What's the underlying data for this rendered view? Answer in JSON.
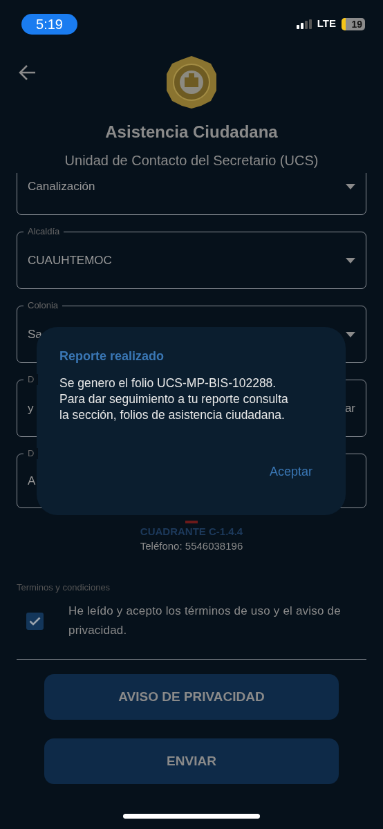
{
  "status_bar": {
    "time": "5:19",
    "network": "LTE",
    "battery": "19"
  },
  "header": {
    "title": "Asistencia Ciudadana",
    "subtitle": "Unidad de Contacto del Secretario (UCS)"
  },
  "fields": [
    {
      "value": "Canalización",
      "dropdown": true
    },
    {
      "label": "Alcaldía",
      "value": "CUAUHTEMOC",
      "dropdown": true
    },
    {
      "label": "Colonia",
      "value": "Sa",
      "dropdown": true
    },
    {
      "label": "D",
      "value": "y",
      "value_end": "ar",
      "dropdown": false
    },
    {
      "label": "D",
      "value": "A",
      "dropdown": false
    }
  ],
  "quadrant": {
    "name": "CUADRANTE C-1.4.4",
    "phone": "Teléfono: 5546038196"
  },
  "terms": {
    "heading": "Terminos y condiciones",
    "text": "He leído y acepto los términos de uso y el aviso de privacidad.",
    "checked": true
  },
  "buttons": [
    "AVISO DE PRIVACIDAD",
    "ENVIAR"
  ],
  "dialog": {
    "title": "Reporte realizado",
    "message": "Se genero el folio UCS-MP-BIS-102288.\nPara dar seguimiento a tu reporte consulta\nla sección, folios de asistencia ciudadana.",
    "action": "Aceptar"
  }
}
